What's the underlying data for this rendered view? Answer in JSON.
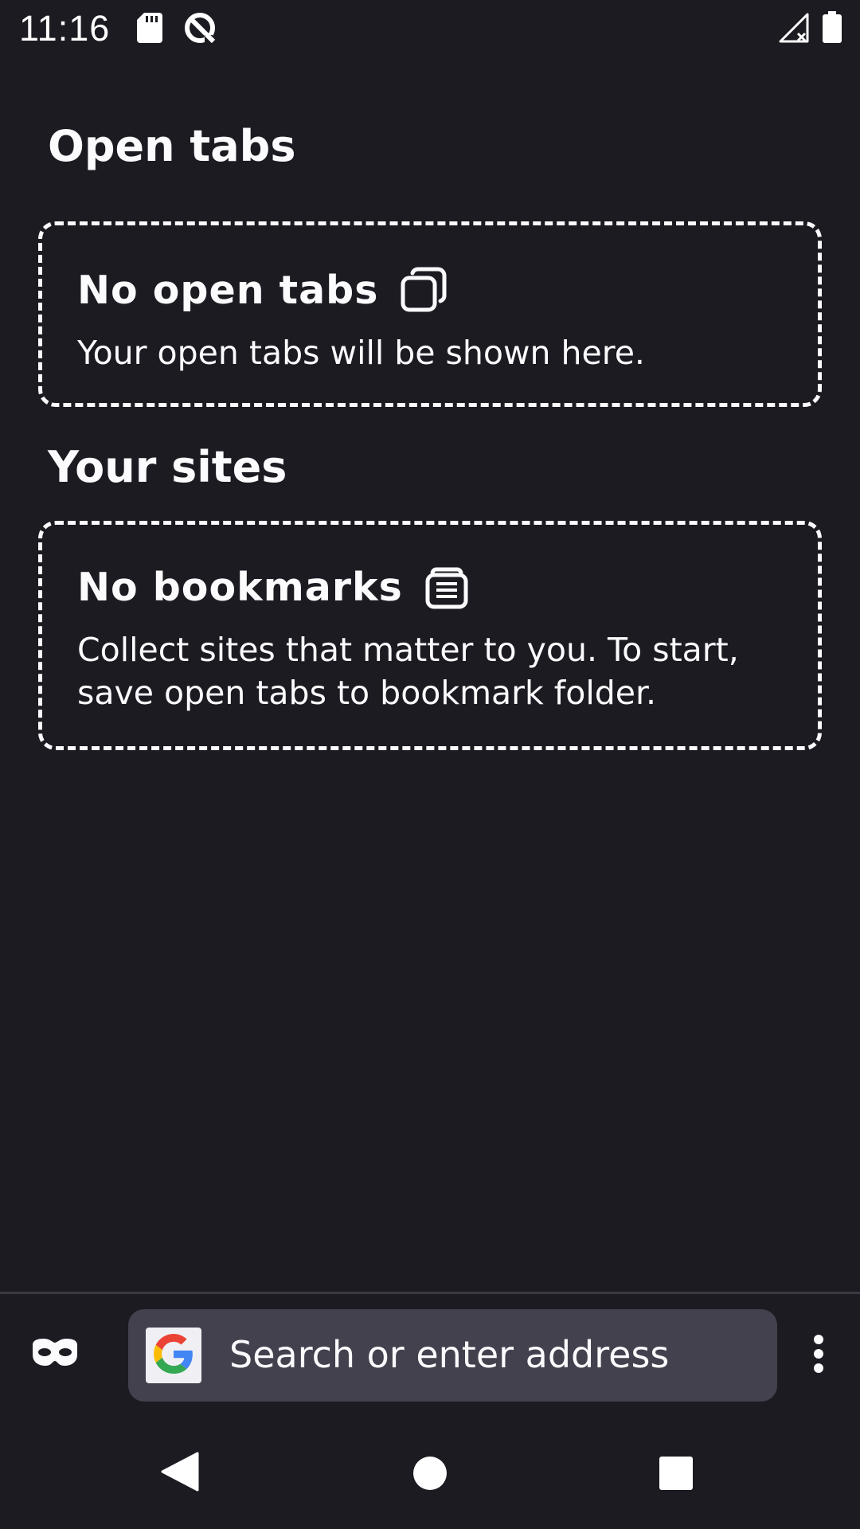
{
  "status_bar": {
    "time": "11:16",
    "icons": [
      "sd-card-icon",
      "data-saver-icon",
      "signal-no-connection-icon",
      "battery-icon"
    ]
  },
  "open_tabs": {
    "heading": "Open tabs",
    "card_title": "No open tabs",
    "card_icon": "tabs-icon",
    "card_body": "Your open tabs will be shown here."
  },
  "your_sites": {
    "heading": "Your sites",
    "card_title": "No bookmarks",
    "card_icon": "bookmark-folder-icon",
    "card_body": "Collect sites that matter to you. To start, save open tabs to bookmark folder."
  },
  "toolbar": {
    "private_icon": "private-mask-icon",
    "search_engine_icon": "google-icon",
    "search_placeholder": "Search or enter address",
    "menu_icon": "more-vertical-icon"
  },
  "nav_bar": {
    "back_icon": "back-triangle-icon",
    "home_icon": "home-circle-icon",
    "recents_icon": "recents-square-icon"
  },
  "colors": {
    "background": "#1c1b22",
    "text": "#fbfbfe",
    "url_bar": "#42414d",
    "divider": "#3a3944"
  }
}
